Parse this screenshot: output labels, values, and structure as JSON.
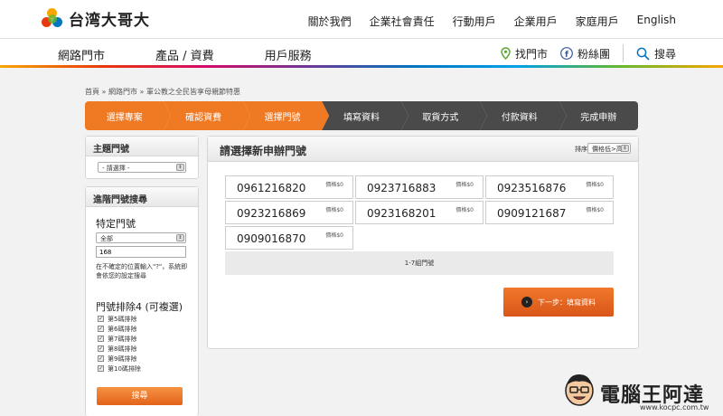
{
  "header": {
    "logo_text": "台湾大哥大",
    "top_links": [
      "關於我們",
      "企業社會責任",
      "行動用戶",
      "企業用戶",
      "家庭用戶",
      "English"
    ]
  },
  "nav": {
    "main_items": [
      "網路門市",
      "產品 / 資費",
      "用戶服務"
    ],
    "find_store": "找門市",
    "fan_page": "粉絲團",
    "search": "搜尋"
  },
  "breadcrumb": "首頁 » 網路門市 » 軍公教之全民皆享母親節特惠",
  "steps": [
    "選擇專案",
    "確認資費",
    "選擇門號",
    "填寫資料",
    "取貨方式",
    "付款資料",
    "完成申辦"
  ],
  "steps_completed": 3,
  "sidebar": {
    "theme_title": "主題門號",
    "theme_select": "- 請選擇 -",
    "advanced_title": "進階門號搜尋",
    "specific_label": "特定門號",
    "specific_select": "全部",
    "specific_input": "168",
    "hint": "在不確定的位置輸入\"?\"，系統即會依您的設定搜尋",
    "exclude_label": "門號排除4 (可複選)",
    "exclude_options": [
      "第5碼排除",
      "第6碼排除",
      "第7碼排除",
      "第8碼排除",
      "第9碼排除",
      "第10碼排除"
    ],
    "search_button": "搜尋"
  },
  "main": {
    "title": "請選擇新申辦門號",
    "sort_label": "排序",
    "sort_select": "價格低>高",
    "numbers": [
      {
        "number": "0961216820",
        "price": "價格$0"
      },
      {
        "number": "0923716883",
        "price": "價格$0"
      },
      {
        "number": "0923516876",
        "price": "價格$0"
      },
      {
        "number": "0923216869",
        "price": "價格$0"
      },
      {
        "number": "0923168201",
        "price": "價格$0"
      },
      {
        "number": "0909121687",
        "price": "價格$0"
      },
      {
        "number": "0909016870",
        "price": "價格$0"
      }
    ],
    "count_text": "1-7組門號",
    "next_button": "下一步：填寫資料"
  },
  "watermark": {
    "text": "電腦王阿達",
    "url": "www.kocpc.com.tw"
  },
  "colors": {
    "accent": "#f07a24",
    "step_inactive": "#4a4a4a"
  }
}
